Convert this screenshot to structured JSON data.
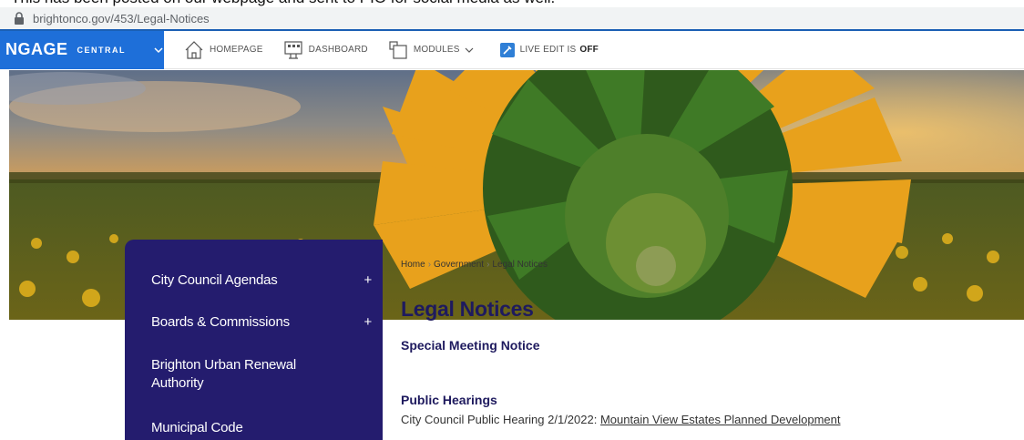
{
  "caption": "This has been posted on our webpage and sent to PIO for social media as well.",
  "browser": {
    "url": "brightonco.gov/453/Legal-Notices"
  },
  "toolbar": {
    "brand_main": "NGAGE",
    "brand_sub": "CENTRAL",
    "homepage": "HOMEPAGE",
    "dashboard": "DASHBOARD",
    "modules": "MODULES",
    "live_edit_label": "LIVE EDIT IS",
    "live_edit_state": "OFF"
  },
  "sidebar": {
    "items": [
      {
        "label": "City Council Agendas",
        "expand": "+"
      },
      {
        "label": "Boards & Commissions",
        "expand": "+"
      },
      {
        "label": "Brighton Urban Renewal Authority"
      },
      {
        "label": "Municipal Code"
      }
    ]
  },
  "breadcrumb": {
    "home": "Home",
    "sep": "›",
    "government": "Government",
    "current": "Legal Notices"
  },
  "page": {
    "title": "Legal Notices",
    "subtitle": "Special Meeting Notice",
    "public_hearings_title": "Public Hearings",
    "hearing_prefix": "City Council Public Hearing 2/1/2022:",
    "hearing_link": "Mountain View Estates Planned Development"
  },
  "colors": {
    "brand_blue": "#1e6fd9",
    "nav_purple": "#241c6e",
    "heading_navy": "#1e1a5e"
  }
}
